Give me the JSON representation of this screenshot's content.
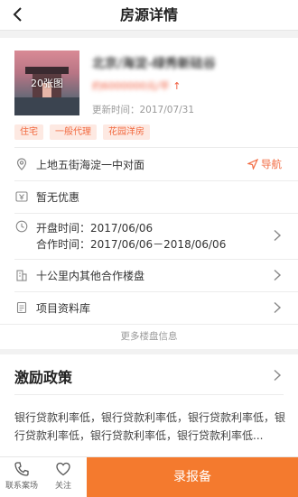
{
  "header": {
    "title": "房源详情"
  },
  "project": {
    "name": "北京/海淀-绿秀新砝谷",
    "price_value": "约6000000元/平",
    "price_arrow": "↑",
    "updated": "更新时间：2017/07/31",
    "image_caption": "20张图",
    "tags": [
      "住宅",
      "一般代理",
      "花园洋房"
    ]
  },
  "rows": {
    "address": "上地五街海淀一中对面",
    "navigate": "导航",
    "discount": "暂无优惠",
    "open_date": "开盘时间：2017/06/06",
    "coop_date": "合作时间：2017/06/06－2018/06/06",
    "nearby": "十公里内其他合作楼盘",
    "docs": "项目资料库",
    "more": "更多楼盘信息"
  },
  "incentive": {
    "title": "激励政策",
    "body": "银行贷款利率低，银行贷款利率低，银行贷款利率低，银行贷款利率低，银行贷款利率低，银行贷款利率低..."
  },
  "bottom": {
    "contact": "联系案场",
    "follow": "关注",
    "report": "录报备"
  },
  "colors": {
    "accent": "#f47a2e",
    "price": "#f05a3c",
    "tag_bg": "#fde9e2"
  },
  "icons": [
    "back-icon",
    "location-icon",
    "navigate-icon",
    "yen-icon",
    "clock-icon",
    "building-icon",
    "document-icon",
    "chevron-right-icon",
    "phone-icon",
    "heart-icon"
  ]
}
